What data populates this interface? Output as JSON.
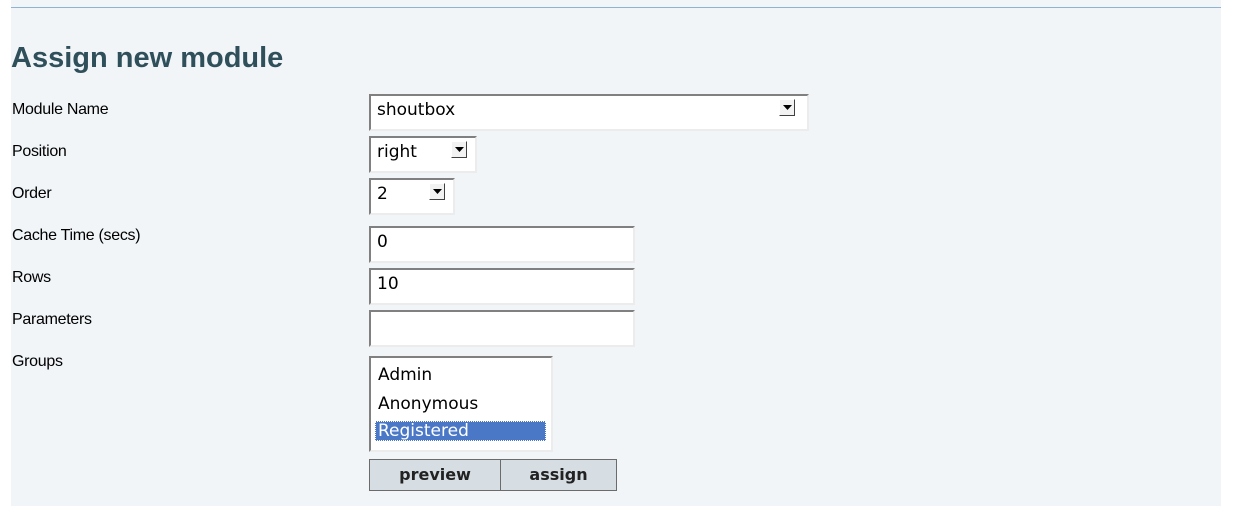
{
  "form": {
    "title": "Assign new module",
    "labels": {
      "module_name": "Module Name",
      "position": "Position",
      "order": "Order",
      "cache_time": "Cache Time (secs)",
      "rows": "Rows",
      "parameters": "Parameters",
      "groups": "Groups"
    },
    "values": {
      "module_name": "shoutbox",
      "position": "right",
      "order": "2",
      "cache_time": "0",
      "rows": "10",
      "parameters": ""
    },
    "groups": [
      {
        "label": "Admin",
        "selected": false
      },
      {
        "label": "Anonymous",
        "selected": false
      },
      {
        "label": "Registered",
        "selected": true
      }
    ],
    "buttons": {
      "preview": "preview",
      "assign": "assign"
    }
  },
  "colors": {
    "panel_bg": "#f1f5f8",
    "heading": "#2f4f5a",
    "selection": "#4a78c7",
    "button_bg": "#d6dde3",
    "rule": "#8fb3d1"
  }
}
